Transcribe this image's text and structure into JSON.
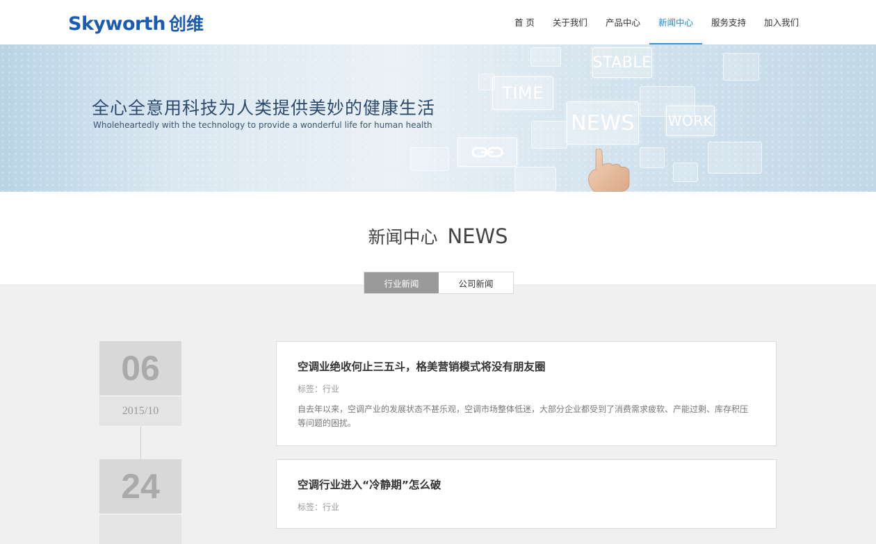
{
  "header": {
    "logo_en": "Skyworth",
    "logo_cn": "创维",
    "nav": [
      {
        "label": "首 页"
      },
      {
        "label": "关于我们"
      },
      {
        "label": "产品中心"
      },
      {
        "label": "新闻中心",
        "active": true
      },
      {
        "label": "服务支持"
      },
      {
        "label": "加入我们"
      }
    ]
  },
  "banner": {
    "title": "全心全意用科技为人类提供美妙的健康生活",
    "subtitle": "Wholeheartedly with the technology to provide a wonderful life for human health",
    "tiles": {
      "stable": "STABLE",
      "time": "TIME",
      "news": "NEWS",
      "work": "WORK"
    }
  },
  "section": {
    "title_cn": "新闻中心",
    "title_en": "NEWS"
  },
  "tabs": [
    {
      "label": "行业新闻",
      "active": true
    },
    {
      "label": "公司新闻",
      "active": false
    }
  ],
  "news": [
    {
      "day": "06",
      "year_month": "2015/10",
      "title": "空调业绝收何止三五斗，格美营销模式将没有朋友圈",
      "tag": "标签：行业",
      "desc": "自去年以来，空调产业的发展状态不甚乐观，空调市场整体低迷，大部分企业都受到了消费需求疲软、产能过剩、库存积压等问题的困扰。"
    },
    {
      "day": "24",
      "year_month": "",
      "title": "空调行业进入“冷静期”怎么破",
      "tag": "标签：行业",
      "desc": ""
    }
  ],
  "colors": {
    "brand": "#1a5cb4",
    "nav_active": "#1a8ad8",
    "tab_active_bg": "#9a9a9a",
    "page_bg": "#f0f0f0"
  }
}
